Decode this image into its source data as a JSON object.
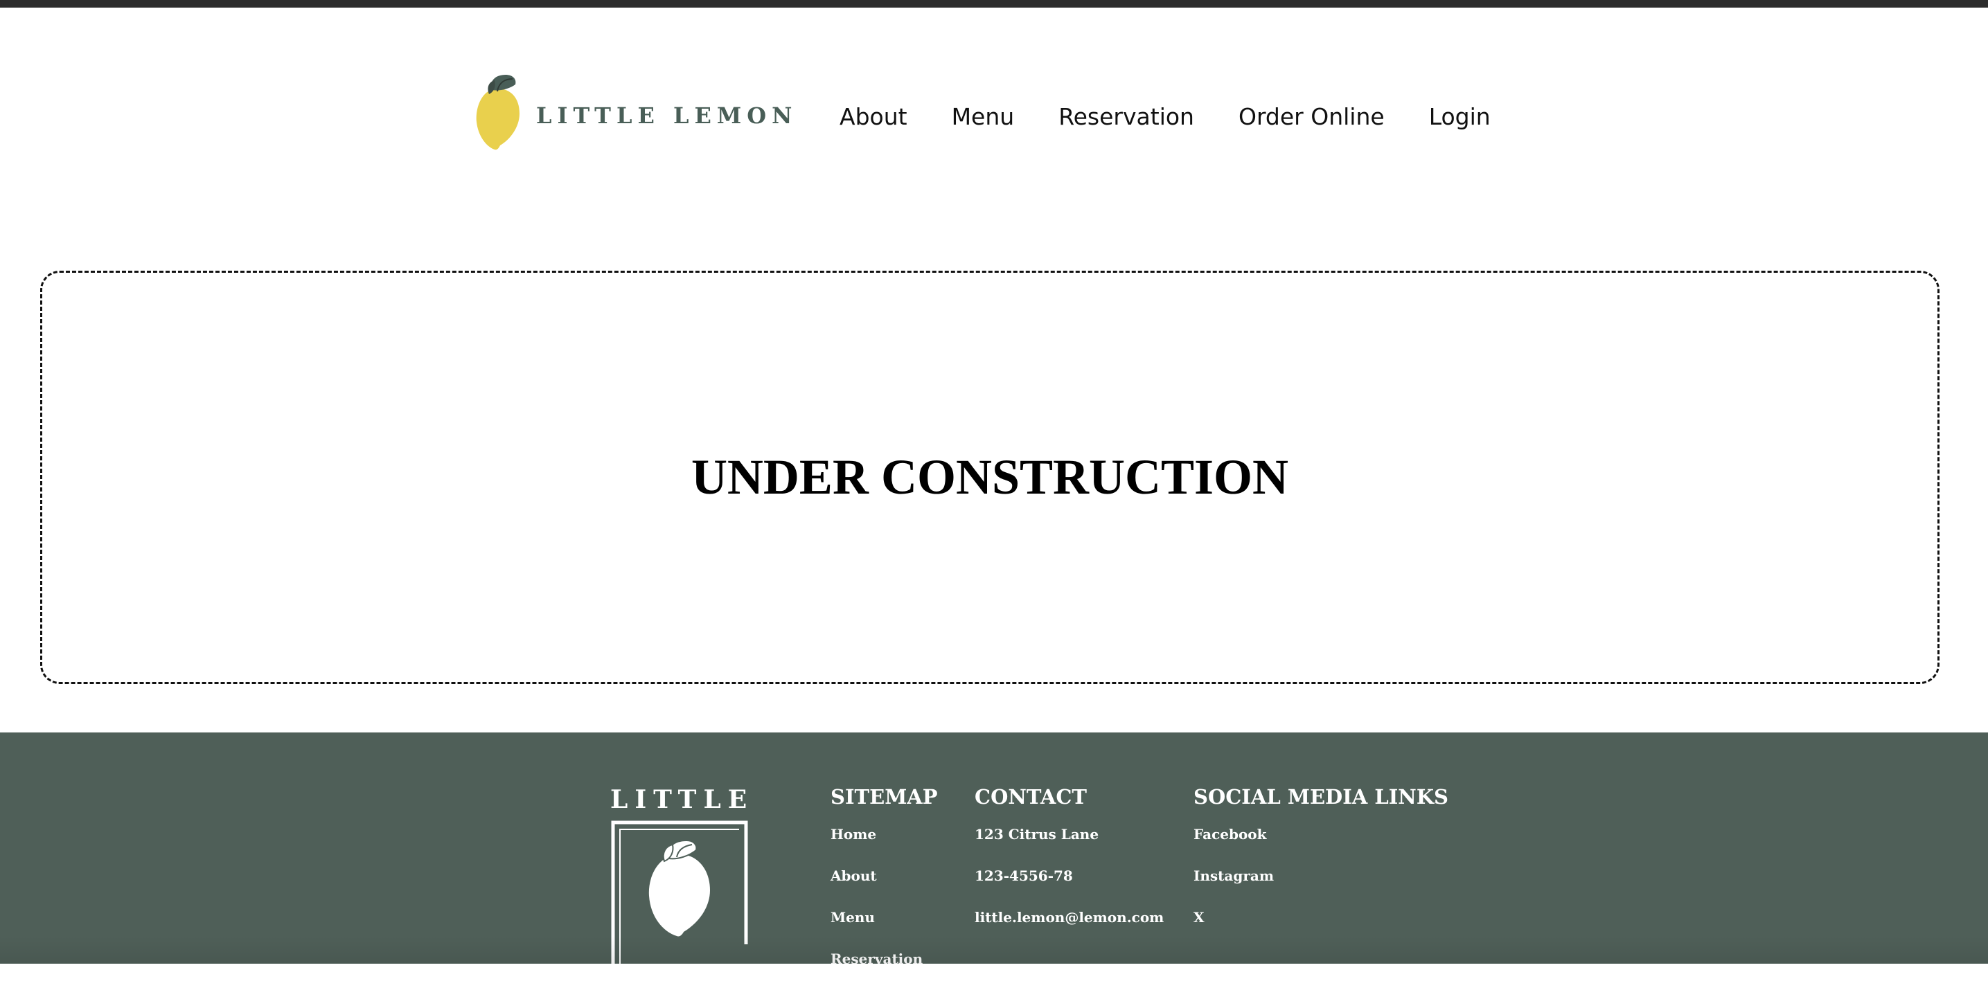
{
  "brand": {
    "logo_text": "LITTLE LEMON",
    "footer_logo_text": "LITTLE",
    "colors": {
      "primary_green": "#495e57",
      "lemon_yellow": "#e9d04d",
      "footer_bg": "#4f5f58",
      "top_bar": "#2c2c2c"
    }
  },
  "nav": {
    "items": [
      {
        "label": "About"
      },
      {
        "label": "Menu"
      },
      {
        "label": "Reservation"
      },
      {
        "label": "Order Online"
      },
      {
        "label": "Login"
      }
    ]
  },
  "main": {
    "heading": "UNDER CONSTRUCTION"
  },
  "footer": {
    "sitemap": {
      "title": "SITEMAP",
      "links": [
        "Home",
        "About",
        "Menu",
        "Reservation"
      ]
    },
    "contact": {
      "title": "CONTACT",
      "lines": [
        "123 Citrus Lane",
        "123-4556-78",
        "little.lemon@lemon.com"
      ]
    },
    "social": {
      "title": "SOCIAL MEDIA LINKS",
      "links": [
        "Facebook",
        "Instagram",
        "X"
      ]
    }
  },
  "icons": {
    "header_logo": "lemon-icon",
    "footer_logo": "lemon-outline-icon"
  }
}
